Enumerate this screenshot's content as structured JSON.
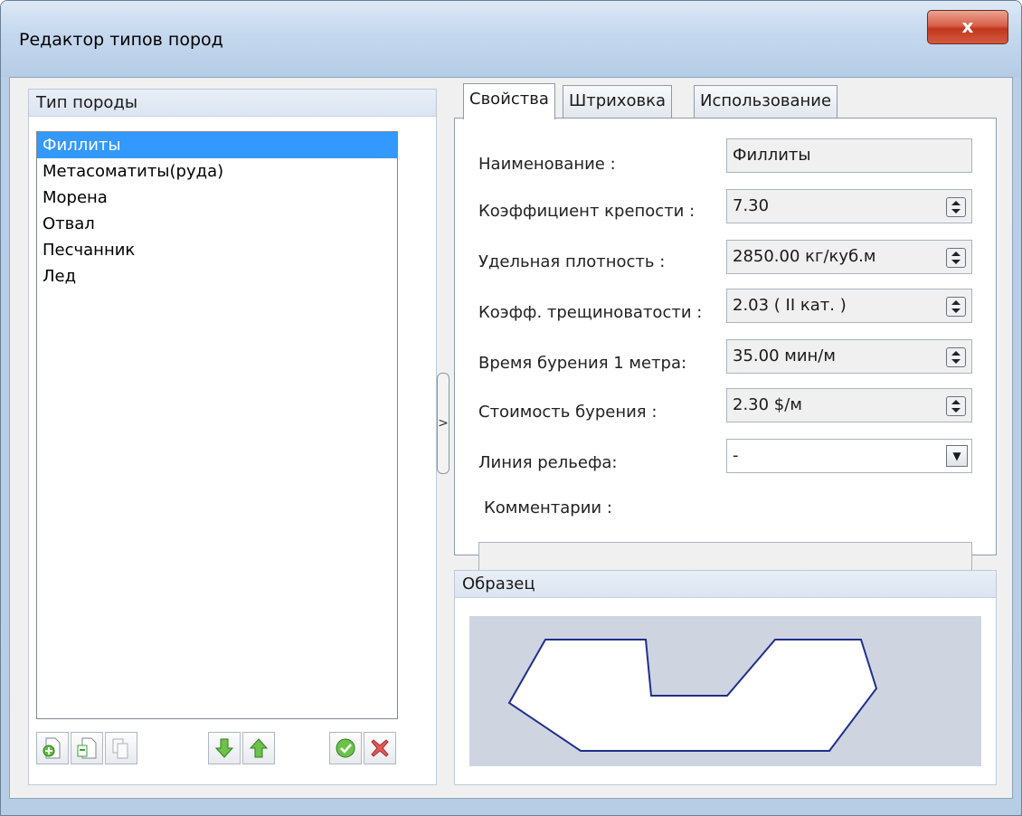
{
  "window": {
    "title": "Редактор типов пород",
    "close_label": "x"
  },
  "left_panel": {
    "header": "Тип породы",
    "items": [
      {
        "label": "Филлиты",
        "selected": true
      },
      {
        "label": "Метасоматиты(руда)",
        "selected": false
      },
      {
        "label": "Морена",
        "selected": false
      },
      {
        "label": "Отвал",
        "selected": false
      },
      {
        "label": "Песчанник",
        "selected": false
      },
      {
        "label": "Лед",
        "selected": false
      }
    ],
    "toolbar_icons": [
      "add-icon",
      "copy-icon",
      "paste-icon",
      "move-down-icon",
      "move-up-icon",
      "apply-icon",
      "delete-icon"
    ]
  },
  "splitter": {
    "glyph": ">"
  },
  "tabs": [
    {
      "label": "Свойства",
      "active": true
    },
    {
      "label": "Штриховка",
      "active": false
    },
    {
      "label": "Использование",
      "active": false
    }
  ],
  "properties": {
    "name": {
      "label": "Наименование :",
      "value": "Филлиты"
    },
    "strength": {
      "label": "Коэффициент крепости :",
      "value": "7.30"
    },
    "density": {
      "label": "Удельная плотность :",
      "value": "2850.00 кг/куб.м"
    },
    "fracture": {
      "label": "Коэфф. трещиноватости :",
      "value": "2.03 ( II кат. )"
    },
    "drill_time": {
      "label": "Время  бурения 1 метра:",
      "value": "35.00 мин/м"
    },
    "drill_cost": {
      "label": "Стоимость бурения :",
      "value": "2.30 $/м"
    },
    "relief_line": {
      "label": "Линия рельефа:",
      "value": "-"
    },
    "comments": {
      "label": "Комментарии :",
      "value": ""
    }
  },
  "sample": {
    "header": "Образец"
  },
  "colors": {
    "selection": "#3399ff",
    "outline": "#1f2f8a",
    "sample_bg": "#ced5e1"
  }
}
